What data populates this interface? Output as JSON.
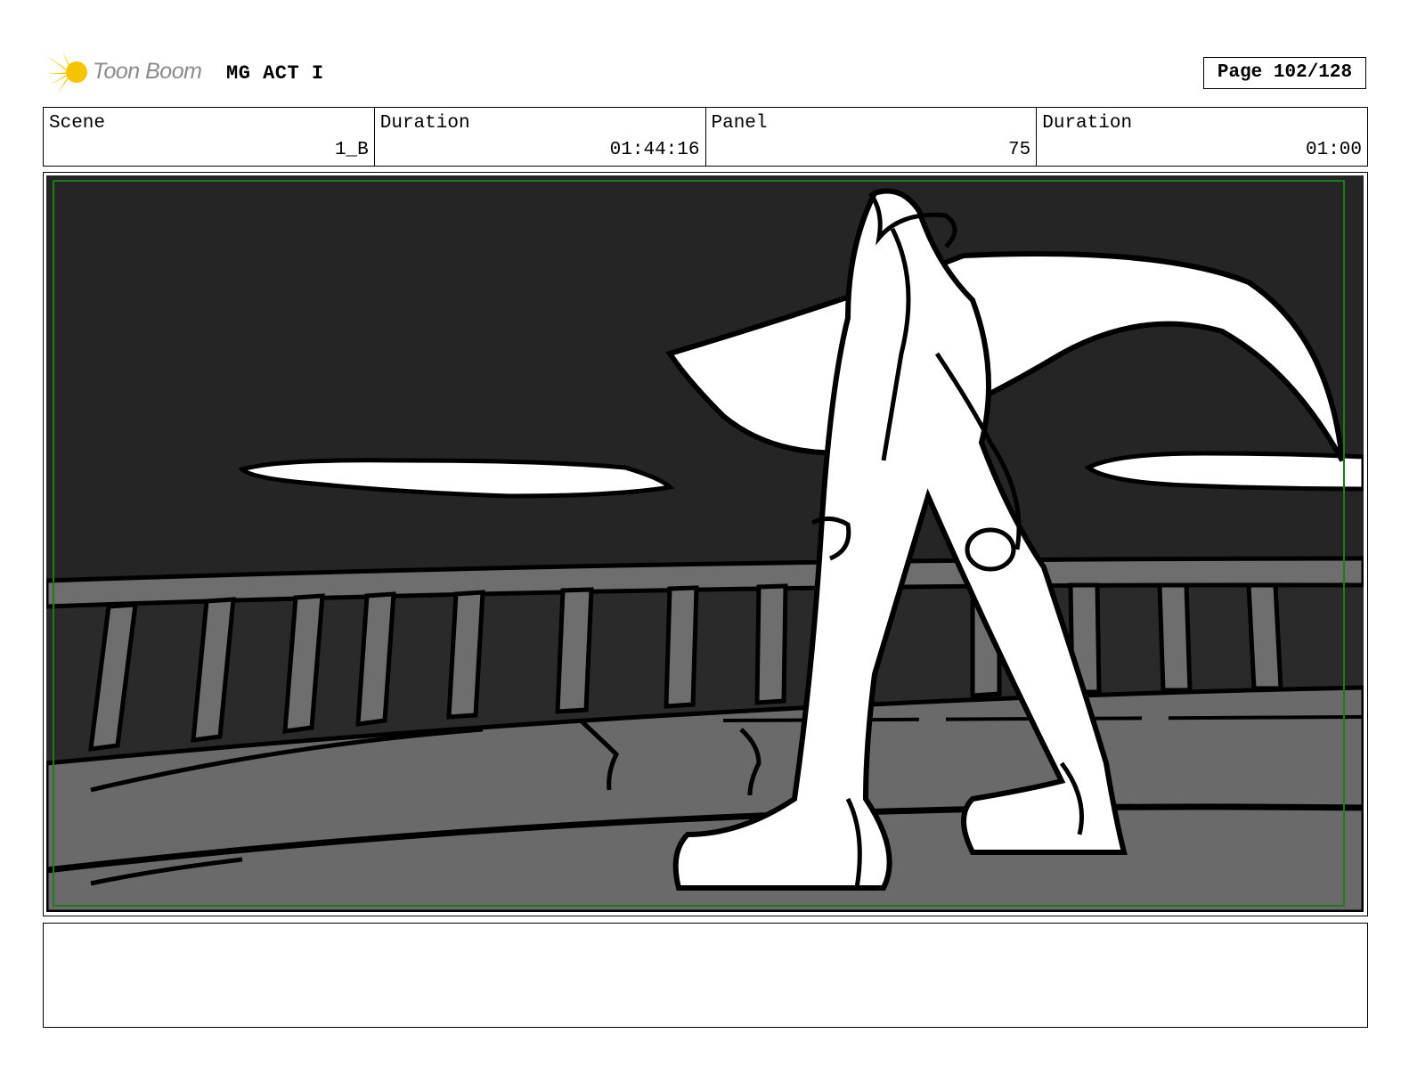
{
  "header": {
    "logo_text": "Toon Boom",
    "project_title": "MG ACT I",
    "page_label": "Page 102/128"
  },
  "info_bar": {
    "scene_label": "Scene",
    "scene_value": "1_B",
    "duration_label": "Duration",
    "duration_value": "01:44:16",
    "panel_label": "Panel",
    "panel_value": "75",
    "panel_duration_label": "Duration",
    "panel_duration_value": "01:00"
  },
  "colors": {
    "logo_star": "#f5c400",
    "logo_text": "#8a8a8a",
    "sky": "#252525",
    "railing": "#6e6e6e",
    "floor": "#6a6a6a",
    "safe_frame": "#1e7a1e"
  },
  "notes": {
    "text": ""
  }
}
